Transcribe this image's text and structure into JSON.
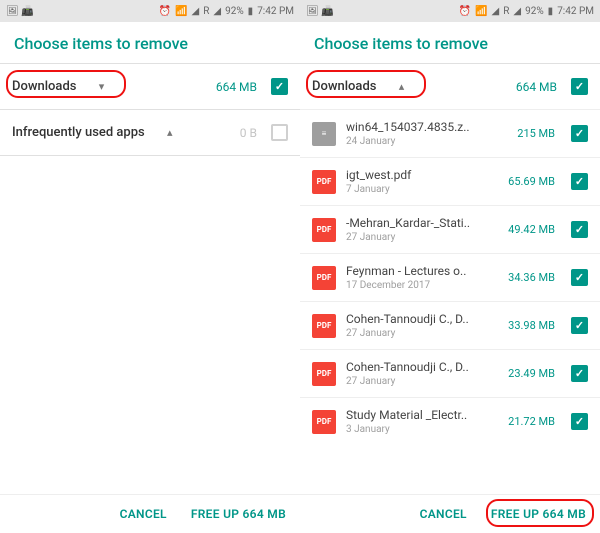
{
  "status": {
    "time": "7:42 PM",
    "battery": "92%",
    "network": "R",
    "icons": "🖼 📠"
  },
  "header": "Choose items to remove",
  "left": {
    "downloads": {
      "label": "Downloads",
      "size": "664 MB",
      "expanded": false
    },
    "infrequent": {
      "label": "Infrequently used apps",
      "size": "0 B"
    }
  },
  "right": {
    "downloads": {
      "label": "Downloads",
      "size": "664 MB",
      "expanded": true
    },
    "items": [
      {
        "name": "win64_154037.4835.z..",
        "date": "24 January",
        "size": "215 MB",
        "type": "zip"
      },
      {
        "name": "igt_west.pdf",
        "date": "7 January",
        "size": "65.69 MB",
        "type": "pdf"
      },
      {
        "name": "-Mehran_Kardar-_Stati..",
        "date": "27 January",
        "size": "49.42 MB",
        "type": "pdf"
      },
      {
        "name": "Feynman - Lectures o..",
        "date": "17 December 2017",
        "size": "34.36 MB",
        "type": "pdf"
      },
      {
        "name": "Cohen-Tannoudji C., D..",
        "date": "27 January",
        "size": "33.98 MB",
        "type": "pdf"
      },
      {
        "name": "Cohen-Tannoudji C., D..",
        "date": "27 January",
        "size": "23.49 MB",
        "type": "pdf"
      },
      {
        "name": "Study Material _Electr..",
        "date": "3 January",
        "size": "21.72 MB",
        "type": "pdf"
      }
    ]
  },
  "footer": {
    "cancel": "CANCEL",
    "confirm": "FREE UP 664 MB"
  },
  "icon_glyphs": {
    "zip": "≡",
    "pdf": "PDF"
  },
  "highlight": {
    "color": "#e11"
  }
}
